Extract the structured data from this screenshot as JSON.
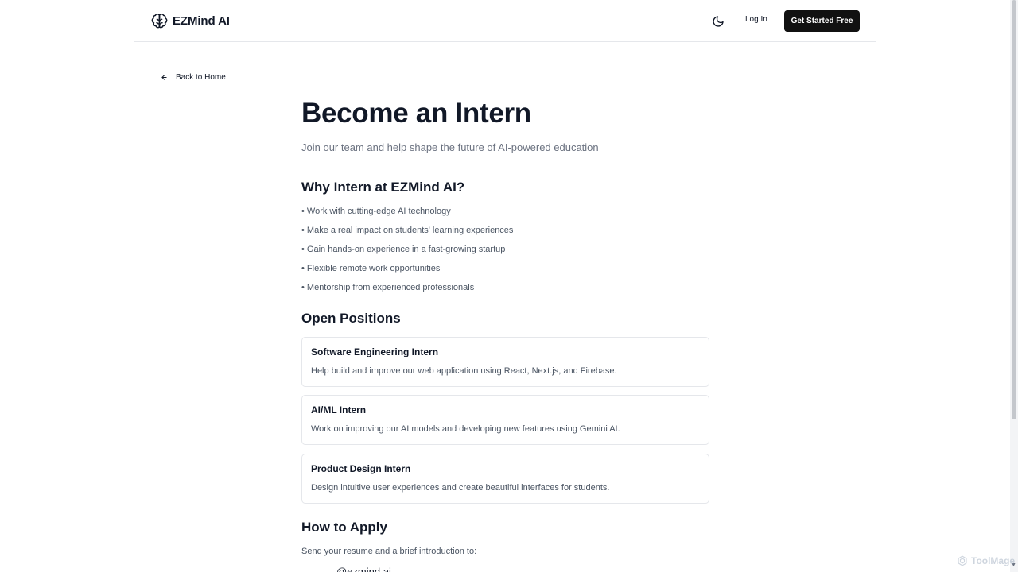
{
  "header": {
    "brand": "EZMind AI",
    "brand_icon": "brain-icon",
    "theme_icon": "moon-icon",
    "login_label": "Log In",
    "cta_label": "Get Started Free"
  },
  "back": {
    "icon": "arrow-left-icon",
    "label": "Back to Home"
  },
  "main": {
    "title": "Become an Intern",
    "subtitle": "Join our team and help shape the future of AI-powered education",
    "why": {
      "heading": "Why Intern at EZMind AI?",
      "items": [
        "• Work with cutting-edge AI technology",
        "• Make a real impact on students' learning experiences",
        "• Gain hands-on experience in a fast-growing startup",
        "• Flexible remote work opportunities",
        "• Mentorship from experienced professionals"
      ]
    },
    "positions": {
      "heading": "Open Positions",
      "items": [
        {
          "title": "Software Engineering Intern",
          "description": "Help build and improve our web application using React, Next.js, and Firebase."
        },
        {
          "title": "AI/ML Intern",
          "description": "Work on improving our AI models and developing new features using Gemini AI."
        },
        {
          "title": "Product Design Intern",
          "description": "Design intuitive user experiences and create beautiful interfaces for students."
        }
      ]
    },
    "apply": {
      "heading": "How to Apply",
      "text": "Send your resume and a brief introduction to:",
      "email_partial": "@ezmind.ai"
    }
  },
  "watermark": {
    "text": "ToolMage"
  },
  "colors": {
    "text_primary": "#111827",
    "text_muted": "#6b7280",
    "cta_background": "#111111",
    "border": "#e5e7eb"
  }
}
